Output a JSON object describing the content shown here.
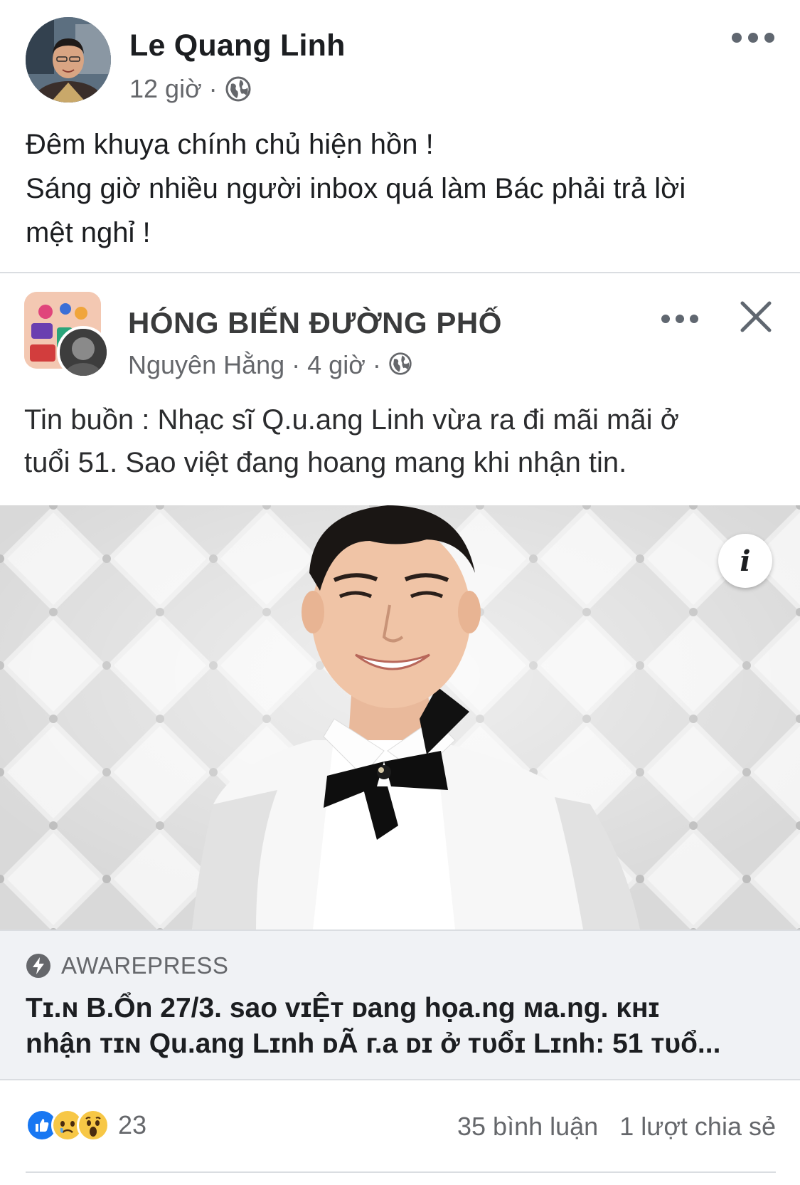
{
  "post": {
    "author": "Le Quang Linh",
    "time": "12 giờ",
    "separator": "·",
    "text_lines": [
      "Đêm khuya chính chủ hiện hồn !",
      "Sáng giờ nhiều người inbox quá làm Bác phải trả lời",
      "mệt nghỉ !"
    ]
  },
  "shared": {
    "group": "HÓNG BIẾN ĐƯỜNG PHỐ",
    "author": "Nguyên Hằng",
    "time": "4 giờ",
    "separator": "·",
    "text_lines": [
      "Tin buồn : Nhạc sĩ Q.u.ang Linh vừa ra đi mãi mãi ở",
      "tuổi 51. Sao việt đang hoang mang khi nhận tin."
    ],
    "info_icon_label": "i",
    "link": {
      "source": "AWAREPRESS",
      "title_lines": [
        "Tɪ.ɴ B.Ổn 27/3. sao ᴠɪỆᴛ ᴅang họa.ng ᴍa.ng. ᴋʜɪ",
        "nhận ᴛɪɴ Qu.ang Lɪnh ᴅÃ г.a ᴅɪ ở ᴛᴜổɪ Lɪnh: 51 ᴛᴜổ..."
      ]
    }
  },
  "reactions": {
    "icons": [
      "like-icon",
      "sad-icon",
      "wow-icon"
    ],
    "count": "23",
    "comments": "35 bình luận",
    "shares": "1 lượt chia sẻ"
  },
  "colors": {
    "text": "#1c1e21",
    "secondary": "#65676b",
    "like_blue": "#1877f2",
    "emoji_yellow": "#f7c746",
    "link_bg": "#f0f2f5"
  }
}
